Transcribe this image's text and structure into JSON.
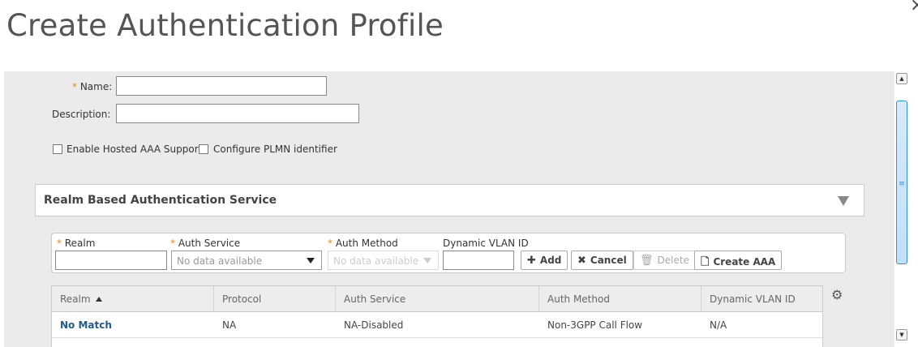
{
  "dialog": {
    "title": "Create Authentication Profile",
    "close_glyph": "×"
  },
  "form": {
    "required_mark": "*",
    "name_label": "Name:",
    "name_value": "",
    "description_label": "Description:",
    "description_value": "",
    "hosted_aaa_label": "Enable Hosted AAA Support",
    "hosted_aaa_checked": false,
    "plmn_label": "Configure PLMN identifier",
    "plmn_checked": false
  },
  "realm_section": {
    "title": "Realm Based Authentication Service",
    "fields": {
      "realm_label": "Realm",
      "auth_service_label": "Auth Service",
      "auth_service_value": "No data available",
      "auth_method_label": "Auth Method",
      "auth_method_value": "No data available",
      "vlan_label": "Dynamic VLAN ID"
    },
    "buttons": {
      "add": "Add",
      "cancel": "Cancel",
      "delete": "Delete",
      "create_aaa": "Create AAA"
    },
    "table": {
      "columns": [
        "Realm",
        "Protocol",
        "Auth Service",
        "Auth Method",
        "Dynamic VLAN ID"
      ],
      "rows": [
        [
          "No Match",
          "NA",
          "NA-Disabled",
          "Non-3GPP Call Flow",
          "N/A"
        ]
      ]
    }
  },
  "colors": {
    "accent_required": "#e08a1f",
    "link": "#1f5a8c",
    "scrollbar": "#3a91d6"
  }
}
